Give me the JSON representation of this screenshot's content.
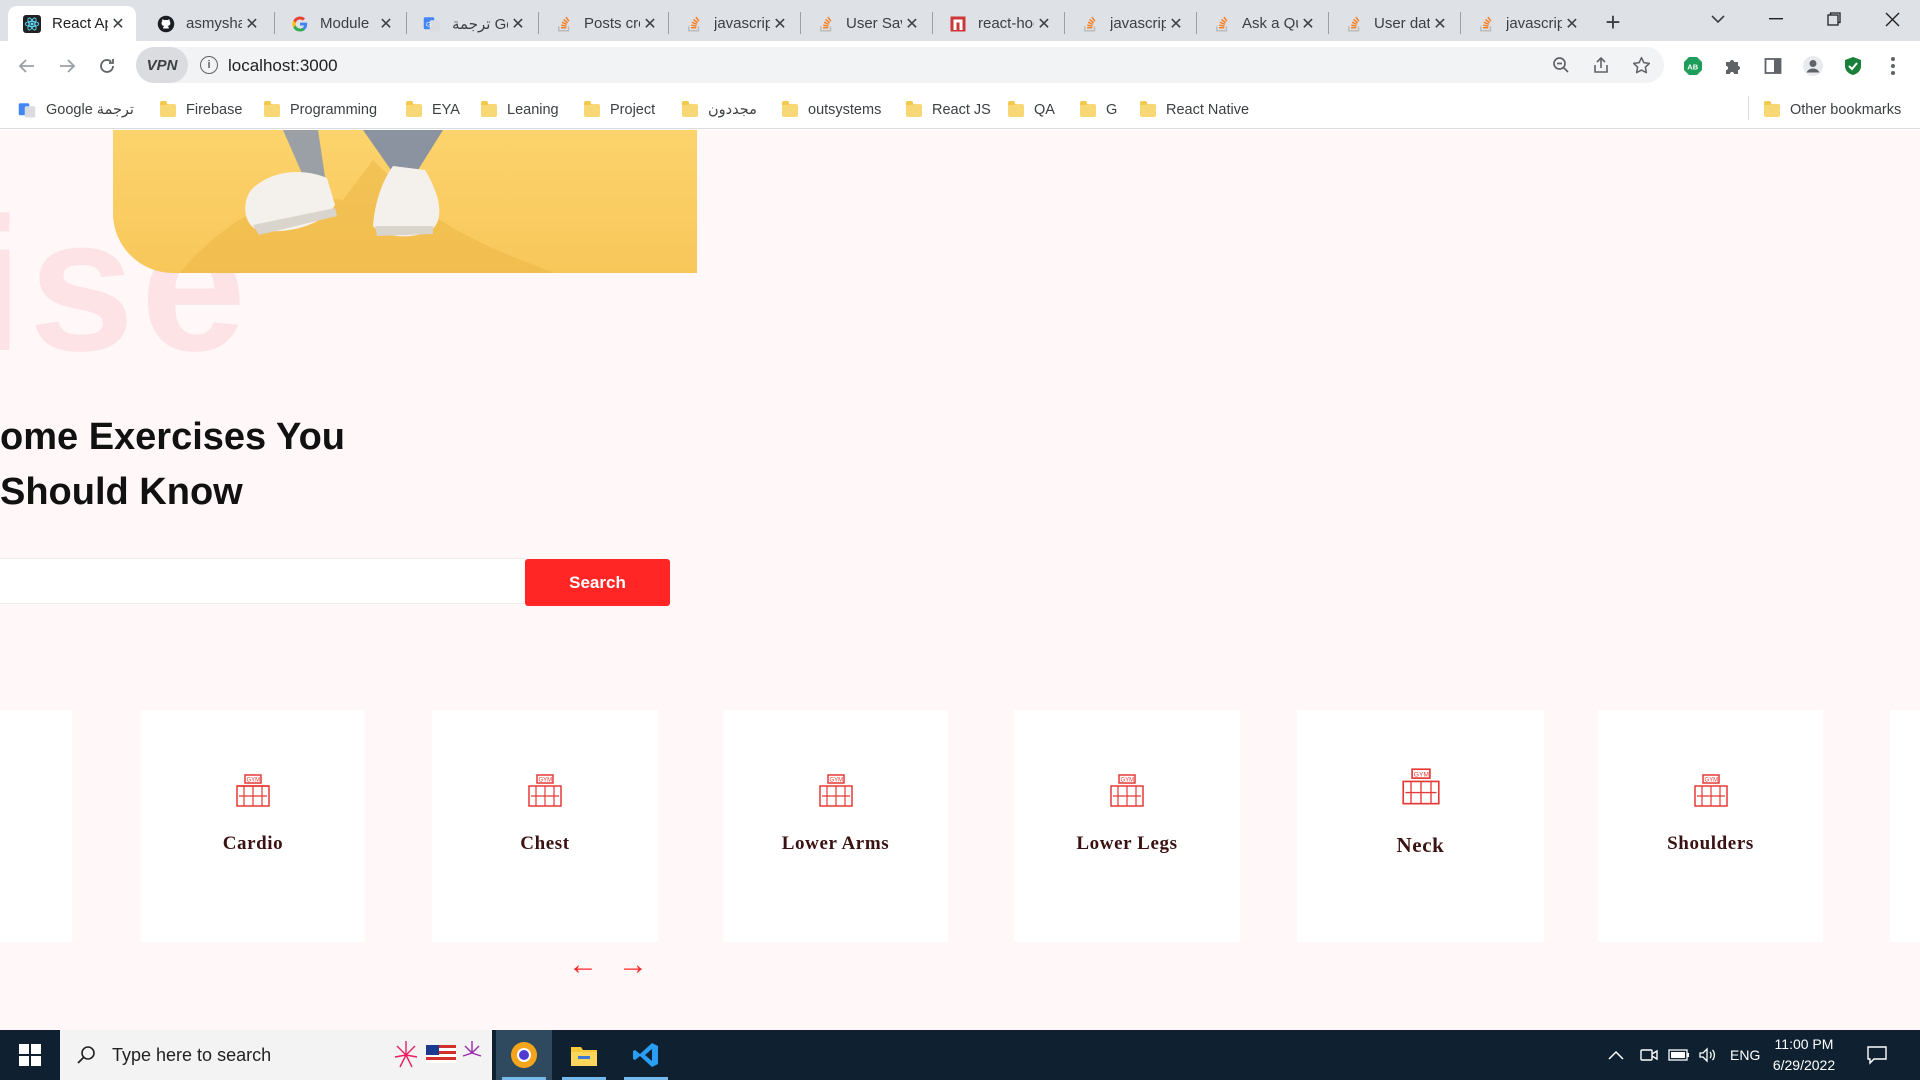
{
  "browser": {
    "tabs": [
      {
        "title": "React App",
        "active": true
      },
      {
        "title": "asmyshaheen"
      },
      {
        "title": "Module"
      },
      {
        "title": "ترجمة Google"
      },
      {
        "title": "Posts created"
      },
      {
        "title": "javascript"
      },
      {
        "title": "User Saved"
      },
      {
        "title": "react-hook"
      },
      {
        "title": "javascript"
      },
      {
        "title": "Ask a Question"
      },
      {
        "title": "User data"
      },
      {
        "title": "javascript"
      }
    ],
    "new_tab_label": "+",
    "url": "localhost:3000",
    "vpn_label": "VPN",
    "bookmarks": [
      {
        "label": "Google ترجمة"
      },
      {
        "label": "Firebase"
      },
      {
        "label": "Programming"
      },
      {
        "label": "EYA"
      },
      {
        "label": "Leaning"
      },
      {
        "label": "Project"
      },
      {
        "label": "مجددون"
      },
      {
        "label": "outsystems"
      },
      {
        "label": "React JS"
      },
      {
        "label": "QA"
      },
      {
        "label": "G"
      },
      {
        "label": "React Native"
      }
    ],
    "other_bookmarks": "Other bookmarks"
  },
  "page": {
    "ghost_text": "ise",
    "heading_line1": "ome Exercises You",
    "heading_line2": "Should Know",
    "search_value": "",
    "search_button": "Search",
    "categories": [
      {
        "label": "Cardio"
      },
      {
        "label": "Chest"
      },
      {
        "label": "Lower Arms"
      },
      {
        "label": "Lower Legs"
      },
      {
        "label": "Neck"
      },
      {
        "label": "Shoulders"
      }
    ],
    "prev_arrow": "←",
    "next_arrow": "→",
    "accent_color": "#ff2625"
  },
  "taskbar": {
    "search_placeholder": "Type here to search",
    "language": "ENG",
    "time": "11:00 PM",
    "date": "6/29/2022"
  }
}
